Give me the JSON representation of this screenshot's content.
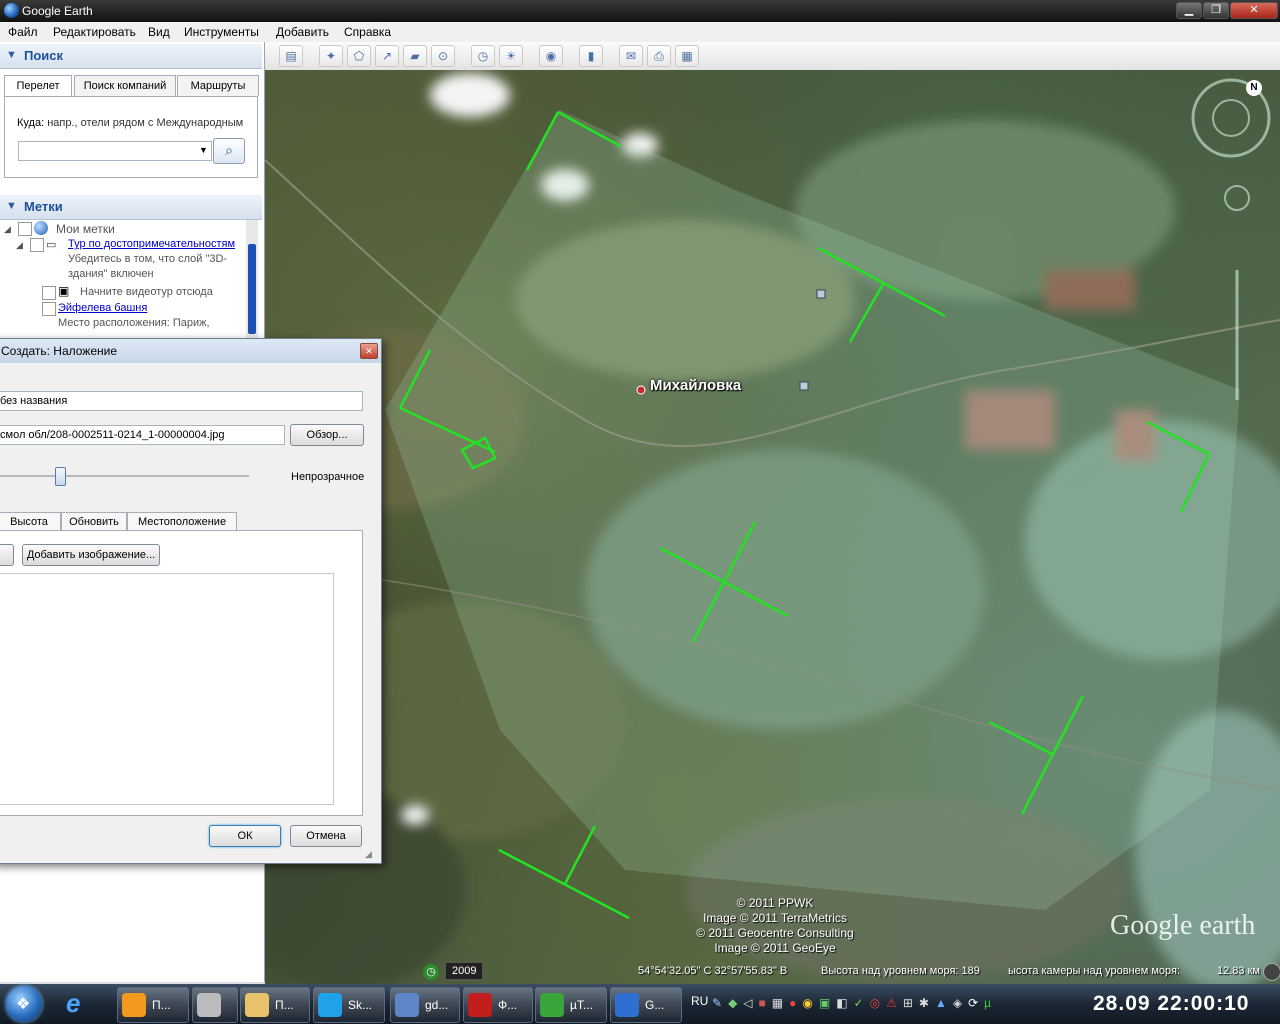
{
  "window": {
    "title": "Google Earth",
    "minimize": "▁",
    "restore": "❐",
    "close": "✕"
  },
  "menu": [
    "Файл",
    "Редактировать",
    "Вид",
    "Инструменты",
    "Добавить",
    "Справка"
  ],
  "search_panel": {
    "header": "Поиск",
    "tabs": [
      "Перелет",
      "Поиск компаний",
      "Маршруты"
    ],
    "where_label": "Куда:",
    "where_hint": "напр., отели рядом с Международным",
    "input_value": ""
  },
  "places_panel": {
    "header": "Метки",
    "items": [
      {
        "label": "Мои метки"
      },
      {
        "label": "Тур по достопримечательностям",
        "link": true
      },
      {
        "label": "Убедитесь в том, что слой \"3D-",
        "sub": true
      },
      {
        "label": "здания\" включен",
        "sub": true
      },
      {
        "label": "Начните видеотур отсюда"
      },
      {
        "label": "Эйфелева башня",
        "link": true
      },
      {
        "label": "Место расположения: Париж,",
        "sub": true
      }
    ]
  },
  "dialog": {
    "title": "Создать: Наложение",
    "name_value": "без названия",
    "link_value": "смол обл/208-0002511-0214_1-00000004.jpg",
    "browse_label": "Обзор...",
    "opacity_label": "Непрозрачное",
    "opacity": 0.25,
    "tabs": [
      "Высота",
      "Обновить",
      "Местоположение"
    ],
    "add_image_label": "Добавить изображение...",
    "ok_label": "ОК",
    "cancel_label": "Отмена"
  },
  "map": {
    "place_label": "Михайловка",
    "attribution": [
      "© 2011 PPWK",
      "Image © 2011 TerraMetrics",
      "© 2011 Geocentre Consulting",
      "Image © 2011 GeoEye"
    ],
    "logo": "Google earth",
    "compass_north": "N"
  },
  "statusbar": {
    "year": "2009",
    "coords": "54°54'32.05\" С  32°57'55.83\" В",
    "elevation": "Высота над уровнем моря: 189",
    "eye_alt": "ысота камеры над уровнем моря:",
    "eye_alt_value": "12.83 км"
  },
  "taskbar": {
    "buttons": [
      {
        "label": "П...",
        "color": "#f39a1e"
      },
      {
        "label": "",
        "color": "#bbb"
      },
      {
        "label": "П...",
        "color": "#e8c26a"
      },
      {
        "label": "Sk...",
        "color": "#1fa2e8"
      },
      {
        "label": "gd...",
        "color": "#5d86c8"
      },
      {
        "label": "Ф...",
        "color": "#c21e1e"
      },
      {
        "label": "µT...",
        "color": "#3aa53a"
      },
      {
        "label": "G...",
        "color": "#2f6fd1"
      }
    ],
    "lang": "RU",
    "clock": "28.09  22:00:10"
  },
  "colors": {
    "overlay_line": "#22e222",
    "link": "#0000cc",
    "header_text": "#1f4f9c"
  }
}
